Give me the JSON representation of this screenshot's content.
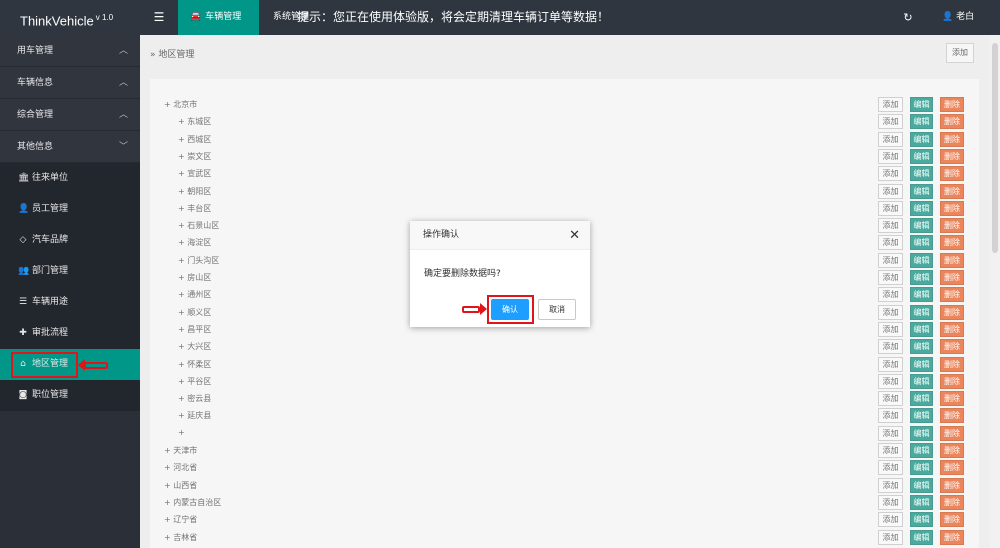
{
  "header": {
    "logo": "ThinkVehicle",
    "version": "v 1.0",
    "menu_icon": "hamburger-icon",
    "active_tab": "车辆管理",
    "system_tab": "系统管理",
    "notice": "提示：您正在使用体验版，将会定期清理车辆订单等数据！",
    "refresh_icon": "refresh-icon",
    "user_name": "老白"
  },
  "sidebar": {
    "groups": [
      {
        "label": "用车管理",
        "chevron": "^"
      },
      {
        "label": "车辆信息",
        "chevron": "^"
      },
      {
        "label": "综合管理",
        "chevron": "^"
      },
      {
        "label": "其他信息",
        "chevron": "v"
      }
    ],
    "items": [
      {
        "label": "往来单位",
        "icon": "bank-icon"
      },
      {
        "label": "员工管理",
        "icon": "user-icon"
      },
      {
        "label": "汽车品牌",
        "icon": "diamond-icon"
      },
      {
        "label": "部门管理",
        "icon": "users-icon"
      },
      {
        "label": "车辆用途",
        "icon": "list-icon"
      },
      {
        "label": "审批流程",
        "icon": "puzzle-icon"
      },
      {
        "label": "地区管理",
        "icon": "home-icon",
        "active": true
      },
      {
        "label": "职位管理",
        "icon": "camera-icon"
      }
    ]
  },
  "main": {
    "breadcrumb_sep": "»",
    "breadcrumb": "地区管理",
    "add_label": "添加",
    "row_buttons": {
      "add": "添加",
      "edit": "编辑",
      "delete": "删除"
    },
    "rows": [
      {
        "label": "+ 北京市",
        "level": 0
      },
      {
        "label": "+ 东城区",
        "level": 1
      },
      {
        "label": "+ 西城区",
        "level": 1
      },
      {
        "label": "+ 崇文区",
        "level": 1
      },
      {
        "label": "+ 宣武区",
        "level": 1
      },
      {
        "label": "+ 朝阳区",
        "level": 1
      },
      {
        "label": "+ 丰台区",
        "level": 1
      },
      {
        "label": "+ 石景山区",
        "level": 1
      },
      {
        "label": "+ 海淀区",
        "level": 1
      },
      {
        "label": "+ 门头沟区",
        "level": 1
      },
      {
        "label": "+ 房山区",
        "level": 1
      },
      {
        "label": "+ 通州区",
        "level": 1
      },
      {
        "label": "+ 顺义区",
        "level": 1
      },
      {
        "label": "+ 昌平区",
        "level": 1
      },
      {
        "label": "+ 大兴区",
        "level": 1
      },
      {
        "label": "+ 怀柔区",
        "level": 1
      },
      {
        "label": "+ 平谷区",
        "level": 1
      },
      {
        "label": "+ 密云县",
        "level": 1
      },
      {
        "label": "+ 延庆县",
        "level": 1
      },
      {
        "label": "+",
        "level": 1
      },
      {
        "label": "+ 天津市",
        "level": 0
      },
      {
        "label": "+ 河北省",
        "level": 0
      },
      {
        "label": "+ 山西省",
        "level": 0
      },
      {
        "label": "+ 内蒙古自治区",
        "level": 0
      },
      {
        "label": "+ 辽宁省",
        "level": 0
      },
      {
        "label": "+ 吉林省",
        "level": 0
      }
    ]
  },
  "modal": {
    "title": "操作确认",
    "close_icon": "close-icon",
    "message": "确定要删除数据吗?",
    "ok_label": "确认",
    "cancel_label": "取消"
  },
  "colors": {
    "accent": "#009688",
    "topbar": "#2f3640",
    "sidebar": "#2b3038",
    "delete": "#e55c24",
    "confirm": "#1e9fff",
    "highlight": "#e0151b"
  }
}
